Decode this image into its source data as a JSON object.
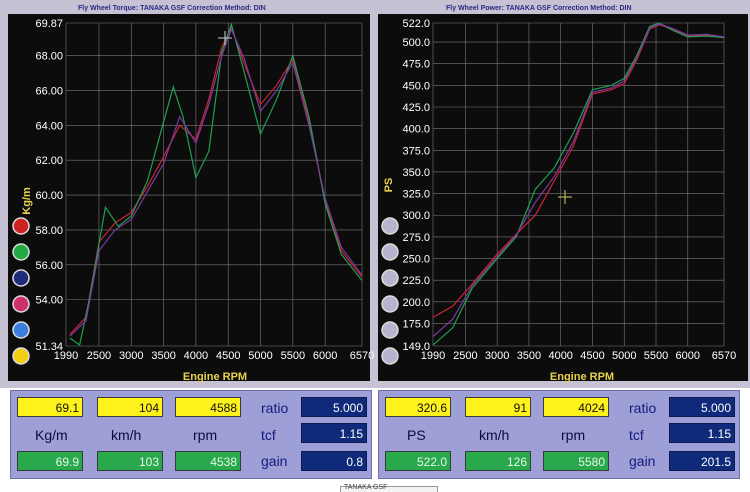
{
  "colors": {
    "plot_bg": "#0c0c0c",
    "grid": "#7a7a7a",
    "tick_text": "#ffffff",
    "axis_title": "#e8d24a",
    "bracket_bg": "#c6c2d3"
  },
  "chart_data": [
    {
      "type": "line",
      "title": "Fly Wheel Torque: TANAKA GSF     Correction Method: DIN",
      "xlabel": "Engine RPM",
      "ylabel": "Kg/m",
      "xlim": [
        1990,
        6570
      ],
      "ylim": [
        51.34,
        69.87
      ],
      "x_ticks": [
        "1990",
        "2500",
        "3000",
        "3500",
        "4000",
        "4500",
        "5000",
        "5500",
        "6000",
        "6570"
      ],
      "y_ticks": [
        "69.87",
        "68.00",
        "66.00",
        "64.00",
        "62.00",
        "60.00",
        "58.00",
        "56.00",
        "54.00",
        "51.34"
      ],
      "run_colors": [
        "#cc2222",
        "#22aa44",
        "#1e2a7a",
        "#d0306a",
        "#3a7fe0",
        "#f0d010"
      ],
      "series": [
        {
          "color": "#cc2233",
          "x": [
            2050,
            2300,
            2500,
            2750,
            3000,
            3250,
            3500,
            3750,
            4000,
            4200,
            4400,
            4550,
            4750,
            5000,
            5250,
            5500,
            5750,
            6000,
            6250,
            6570
          ],
          "y": [
            52.0,
            53.0,
            57.3,
            58.4,
            59.0,
            60.5,
            62.2,
            64.0,
            63.2,
            65.5,
            68.5,
            69.6,
            67.5,
            65.2,
            66.3,
            67.8,
            64.2,
            59.6,
            56.8,
            55.3
          ]
        },
        {
          "color": "#20a050",
          "x": [
            2050,
            2200,
            2350,
            2600,
            2800,
            3000,
            3250,
            3500,
            3650,
            3800,
            4000,
            4200,
            4400,
            4550,
            4750,
            5000,
            5250,
            5500,
            5750,
            6000,
            6250,
            6570
          ],
          "y": [
            51.8,
            51.4,
            54.0,
            59.3,
            58.2,
            58.8,
            60.8,
            64.2,
            66.2,
            64.5,
            61.0,
            62.5,
            68.2,
            69.8,
            67.0,
            63.5,
            65.5,
            68.0,
            64.5,
            59.5,
            56.6,
            55.1
          ]
        },
        {
          "color": "#7a3aa0",
          "x": [
            2050,
            2300,
            2500,
            2750,
            3000,
            3250,
            3500,
            3750,
            4000,
            4200,
            4400,
            4550,
            4750,
            5000,
            5250,
            5500,
            5750,
            6000,
            6250,
            6570
          ],
          "y": [
            51.9,
            52.8,
            56.8,
            58.0,
            58.6,
            60.2,
            61.8,
            64.5,
            63.0,
            65.2,
            68.0,
            69.5,
            67.8,
            64.8,
            66.0,
            67.6,
            64.0,
            59.8,
            57.0,
            55.4
          ]
        }
      ]
    },
    {
      "type": "line",
      "title": "Fly Wheel Power: TANAKA GSF     Correction Method: DIN",
      "xlabel": "Engine RPM",
      "ylabel": "PS",
      "xlim": [
        1990,
        6570
      ],
      "ylim": [
        149.0,
        522.0
      ],
      "x_ticks": [
        "1990",
        "2500",
        "3000",
        "3500",
        "4000",
        "4500",
        "5000",
        "5500",
        "6000",
        "6570"
      ],
      "y_ticks": [
        "522.0",
        "500.0",
        "475.0",
        "450.0",
        "425.0",
        "400.0",
        "375.0",
        "350.0",
        "325.0",
        "300.0",
        "275.0",
        "250.0",
        "225.0",
        "200.0",
        "175.0",
        "149.0"
      ],
      "series": [
        {
          "color": "#cc2233",
          "x": [
            1990,
            2300,
            2600,
            3000,
            3300,
            3600,
            3900,
            4200,
            4500,
            4800,
            5000,
            5200,
            5400,
            5550,
            5750,
            6000,
            6300,
            6570
          ],
          "y": [
            182,
            195,
            220,
            255,
            278,
            300,
            340,
            380,
            440,
            445,
            452,
            480,
            515,
            520,
            515,
            507,
            508,
            505
          ]
        },
        {
          "color": "#20a050",
          "x": [
            1990,
            2300,
            2600,
            3000,
            3300,
            3600,
            3900,
            4200,
            4500,
            4800,
            5000,
            5200,
            5400,
            5550,
            5750,
            6000,
            6300,
            6570
          ],
          "y": [
            150,
            170,
            215,
            250,
            275,
            330,
            355,
            395,
            445,
            450,
            458,
            485,
            518,
            522,
            514,
            506,
            507,
            505
          ]
        },
        {
          "color": "#7a3aa0",
          "x": [
            1990,
            2300,
            2600,
            3000,
            3300,
            3600,
            3900,
            4200,
            4500,
            4800,
            5000,
            5200,
            5400,
            5550,
            5750,
            6000,
            6300,
            6570
          ],
          "y": [
            160,
            180,
            218,
            252,
            277,
            315,
            345,
            385,
            442,
            447,
            455,
            482,
            516,
            521,
            516,
            508,
            509,
            506
          ]
        }
      ]
    }
  ],
  "left_panel": {
    "row1": {
      "value1": "69.1",
      "value2": "104",
      "value3": "4588",
      "key": "ratio",
      "key_value": "5.000"
    },
    "row2": {
      "unit1": "Kg/m",
      "unit2": "km/h",
      "unit3": "rpm",
      "key": "tcf",
      "key_value": "1.15"
    },
    "row3": {
      "value1": "69.9",
      "value2": "103",
      "value3": "4538",
      "key": "gain",
      "key_value": "0.8"
    }
  },
  "right_panel": {
    "row1": {
      "value1": "320.6",
      "value2": "91",
      "value3": "4024",
      "key": "ratio",
      "key_value": "5.000"
    },
    "row2": {
      "unit1": "PS",
      "unit2": "km/h",
      "unit3": "rpm",
      "key": "tcf",
      "key_value": "1.15"
    },
    "row3": {
      "value1": "522.0",
      "value2": "126",
      "value3": "5580",
      "key": "gain",
      "key_value": "201.5"
    }
  },
  "footer": {
    "text": "TANAKA GSF"
  }
}
